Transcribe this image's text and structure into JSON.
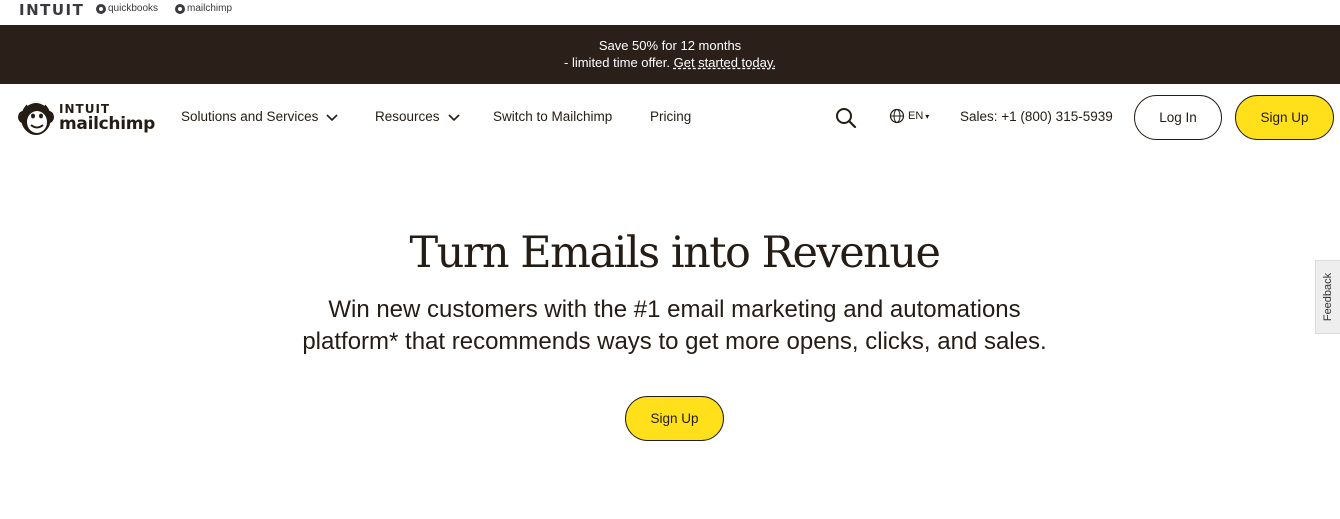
{
  "brand_strip": {
    "intuit": "INTUIT",
    "quickbooks": "quickbooks",
    "mailchimp": "mailchimp"
  },
  "promo": {
    "line1": "Save 50% for 12 months",
    "line2": "- limited time offer.",
    "link": "Get started today."
  },
  "nav": {
    "logo_line1": "INTUIT",
    "logo_line2": "mailchimp",
    "items": [
      {
        "label": "Solutions and Services",
        "has_dropdown": true
      },
      {
        "label": "Resources",
        "has_dropdown": true
      },
      {
        "label": "Switch to Mailchimp",
        "has_dropdown": false
      },
      {
        "label": "Pricing",
        "has_dropdown": false
      }
    ],
    "search_icon": "search-icon",
    "language": "EN",
    "sales": "Sales: +1 (800) 315-5939",
    "login_label": "Log In",
    "signup_label": "Sign Up"
  },
  "hero": {
    "title": "Turn Emails into Revenue",
    "subtitle_line1": "Win new customers with the #1 email marketing and automations",
    "subtitle_line2": "platform* that recommends ways to get more opens, clicks, and sales.",
    "cta_label": "Sign Up"
  },
  "feedback": {
    "label": "Feedback"
  },
  "colors": {
    "promo_bg": "#2b2019",
    "accent_yellow": "#ffe01b",
    "text": "#241c15"
  }
}
